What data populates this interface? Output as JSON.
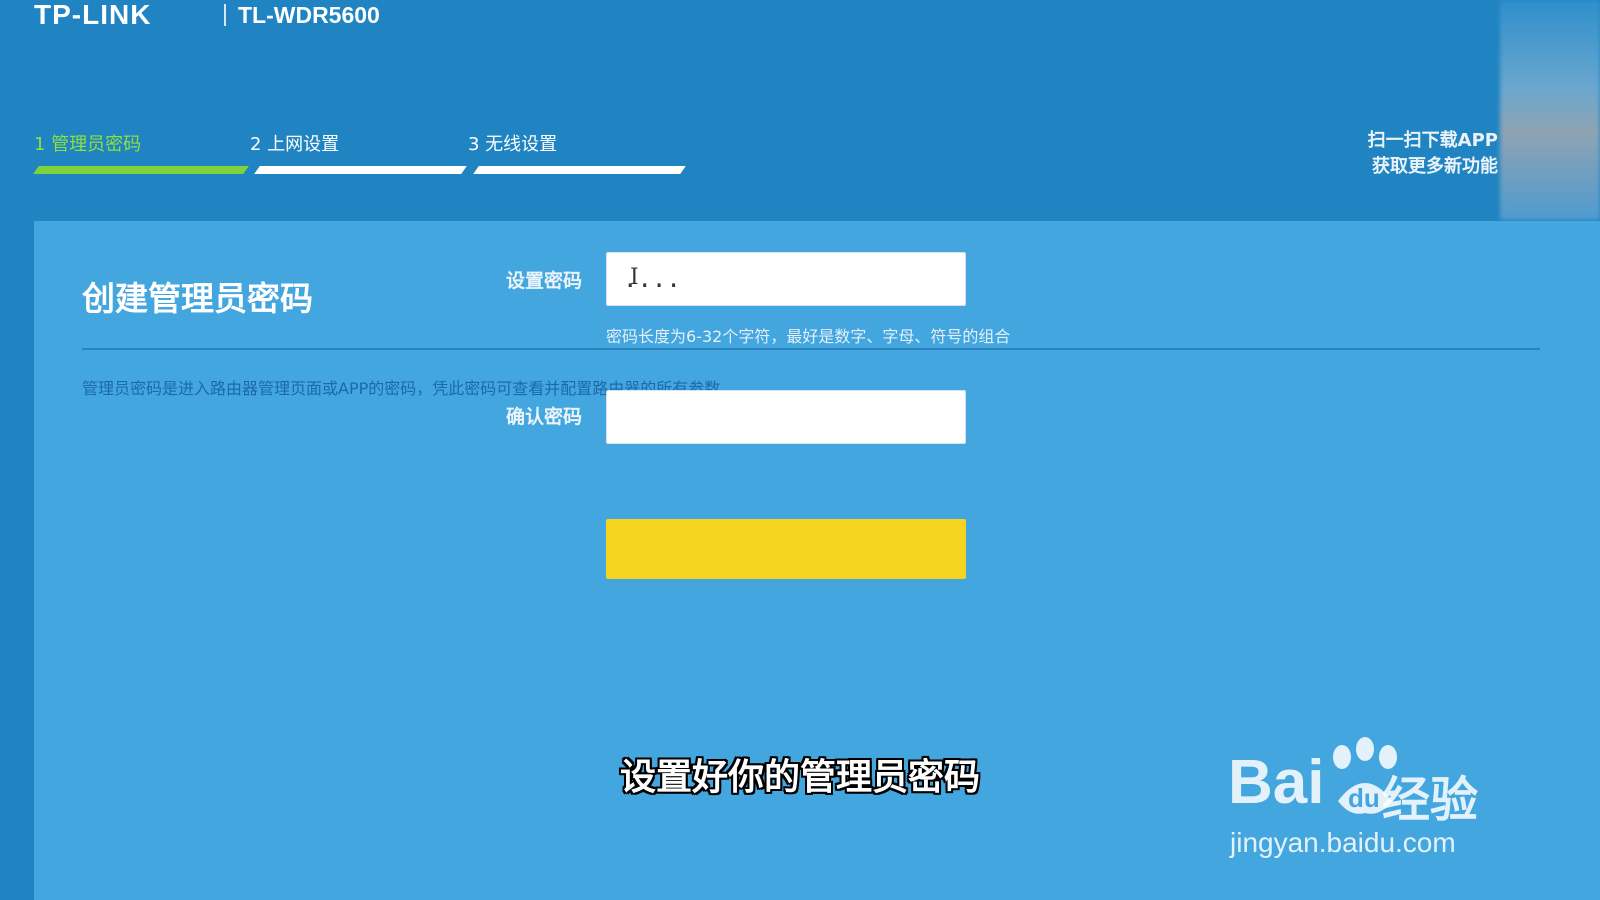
{
  "brand": {
    "logo": "TP-LINK",
    "model": "TL-WDR5600"
  },
  "steps": [
    {
      "label": "1 管理员密码",
      "active": true,
      "color": "#8ee040"
    },
    {
      "label": "2 上网设置",
      "active": false
    },
    {
      "label": "3 无线设置",
      "active": false
    }
  ],
  "app_promo": {
    "line1": "扫一扫下载APP",
    "line2": "获取更多新功能"
  },
  "panel": {
    "title": "创建管理员密码",
    "description": "管理员密码是进入路由器管理页面或APP的密码，凭此密码可查看并配置路由器的所有参数。"
  },
  "form": {
    "password_label": "设置密码",
    "password_value": "....",
    "password_hint": "密码长度为6-32个字符，最好是数字、字母、符号的组合",
    "confirm_label": "确认密码",
    "confirm_value": ""
  },
  "submit_button": {
    "color": "#f4d41e"
  },
  "subtitle": "设置好你的管理员密码",
  "watermark": {
    "logo": "Bai",
    "logo_du": "du",
    "brand": "经验",
    "url": "jingyan.baidu.com"
  },
  "colors": {
    "header_bg": "#1f84c1",
    "panel_bg": "#43a6de",
    "active_step": "#7fd23a"
  },
  "icons": {
    "cursor": "text-cursor-icon",
    "paw": "baidu-paw-icon"
  }
}
